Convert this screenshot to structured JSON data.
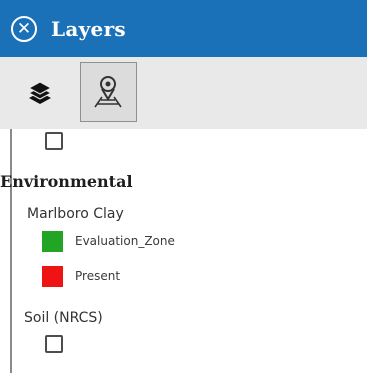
{
  "header": {
    "close_symbol": "✕",
    "title": "Layers",
    "background_color": "#1a71b8"
  },
  "toolbar": {
    "buttons": [
      {
        "icon": "layers-stack-icon",
        "active": false
      },
      {
        "icon": "identify-pin-icon",
        "active": true
      }
    ]
  },
  "layers": {
    "group_title": "Environmental",
    "items": [
      {
        "label": "Marlboro Clay",
        "legend": [
          {
            "label": "Evaluation_Zone",
            "color": "#22a524"
          },
          {
            "label": "Present",
            "color": "#ee1414"
          }
        ]
      },
      {
        "label": "Soil (NRCS)",
        "checked": false
      }
    ]
  }
}
